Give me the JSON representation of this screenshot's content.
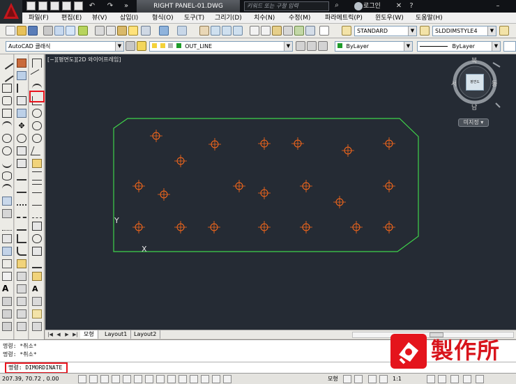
{
  "titlebar": {
    "document_title": "RIGHT PANEL-01.DWG",
    "search_placeholder": "키워드 또는 구절 입력",
    "login_label": "로그인"
  },
  "menu": {
    "items": [
      "파일(F)",
      "편집(E)",
      "뷰(V)",
      "삽입(I)",
      "형식(O)",
      "도구(T)",
      "그리기(D)",
      "치수(N)",
      "수정(M)",
      "파라메트릭(P)",
      "윈도우(W)",
      "도움말(H)"
    ]
  },
  "toolbar_standard": {
    "text_style": "STANDARD",
    "dim_style": "SLDDIMSTYLE4"
  },
  "toolbar_layers": {
    "workspace": "AutoCAD 클래식",
    "layer": "OUT_LINE",
    "color": "ByLayer",
    "linetype": "ByLayer",
    "layer_color": "#1f9c2a"
  },
  "viewport": {
    "view_label": "[−][평면도][2D 와이어프레임]",
    "background": "#252b34",
    "outline_color": "#3fd24a",
    "hole_color": "#ff6a1a",
    "ucs_y_label": "Y",
    "ucs_x_label": "X"
  },
  "viewcube": {
    "north": "북",
    "south": "남",
    "east": "동",
    "west": "서",
    "top_face": "평면도",
    "named_view": "미지정"
  },
  "layout_tabs": [
    "모형",
    "Layout1",
    "Layout2"
  ],
  "command": {
    "history": [
      "명령: *취소*",
      "명령: *취소*"
    ],
    "current": "명령: DIMORDINATE"
  },
  "status": {
    "coordinates": "207.39, 70.72 , 0.00",
    "model_label": "모형",
    "annotation_scale": "1:1"
  },
  "watermark": {
    "text": "製作所"
  }
}
